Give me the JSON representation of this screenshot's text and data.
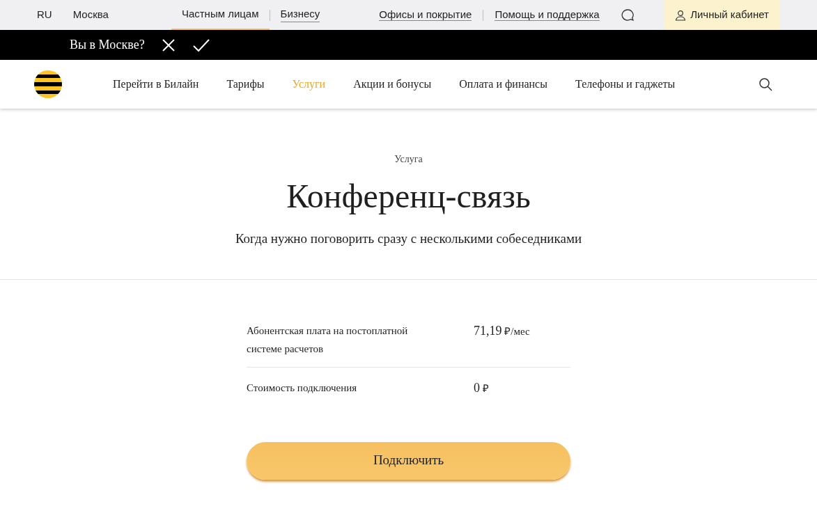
{
  "top_bar": {
    "language": "RU",
    "city": "Москва",
    "segments": [
      {
        "label": "Частным лицам",
        "selected": true
      },
      {
        "label": "Бизнесу",
        "selected": false
      }
    ],
    "links": [
      "Офисы и покрытие",
      "Помощь и поддержка"
    ],
    "account_button": "Личный кабинет"
  },
  "city_prompt": {
    "question": "Вы в Москве?"
  },
  "main_nav": {
    "items": [
      {
        "label": "Перейти в Билайн",
        "selected": false
      },
      {
        "label": "Тарифы",
        "selected": false
      },
      {
        "label": "Услуги",
        "selected": true
      },
      {
        "label": "Акции и бонусы",
        "selected": false
      },
      {
        "label": "Оплата и финансы",
        "selected": false
      },
      {
        "label": "Телефоны и гаджеты",
        "selected": false
      }
    ]
  },
  "hero": {
    "eyebrow": "Услуга",
    "title": "Конференц-связь",
    "subtitle": "Когда нужно поговорить сразу с несколькими собеседниками"
  },
  "prices": [
    {
      "label": "Абонентская плата на постоплатной системе расчетов",
      "amount": "71,19",
      "unit": "₽/мес"
    },
    {
      "label": "Стоимость подключения",
      "amount": "0",
      "unit": "₽"
    }
  ],
  "connect_button": "Подключить"
}
